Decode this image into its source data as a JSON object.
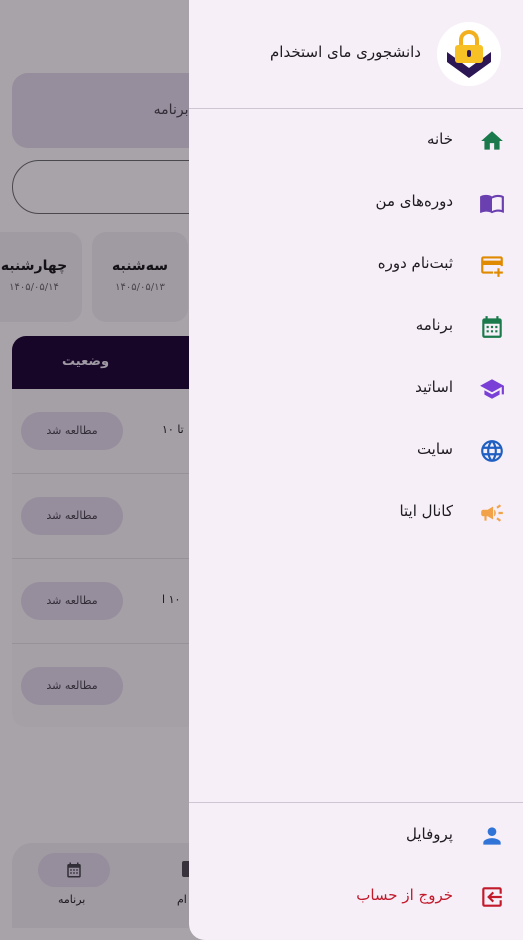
{
  "background": {
    "search_placeholder": "جستجو در برنامه",
    "days": [
      {
        "name": "چهارشنبه",
        "date": "۱۴۰۵/۰۵/۱۴"
      },
      {
        "name": "سه‌شنبه",
        "date": "۱۴۰۵/۰۵/۱۳"
      }
    ],
    "table_header": "وضعیت",
    "rows": [
      {
        "status": "مطالعه شد",
        "text": "تا ۱۰"
      },
      {
        "status": "مطالعه شد",
        "text": ""
      },
      {
        "status": "مطالعه شد",
        "text": "۱۰ ا"
      },
      {
        "status": "مطالعه شد",
        "text": ""
      }
    ],
    "bottom_nav": {
      "active_label": "برنامه",
      "second_label": "ام"
    }
  },
  "drawer": {
    "title": "دانشجوری مای استخدام",
    "menu": [
      {
        "label": "خانه",
        "icon": "home-icon",
        "color": "#1b7a4b"
      },
      {
        "label": "دوره‌های من",
        "icon": "book-icon",
        "color": "#6a3fb0"
      },
      {
        "label": "ثبت‌نام دوره",
        "icon": "card-add-icon",
        "color": "#e08a00"
      },
      {
        "label": "برنامه",
        "icon": "calendar-icon",
        "color": "#1b7a4b"
      },
      {
        "label": "اساتید",
        "icon": "graduation-cap-icon",
        "color": "#7a3fd6"
      },
      {
        "label": "سایت",
        "icon": "globe-icon",
        "color": "#1f5fc2"
      },
      {
        "label": "کانال ایتا",
        "icon": "megaphone-icon",
        "color": "#f2a34a"
      }
    ],
    "footer": [
      {
        "label": "پروفایل",
        "icon": "person-icon",
        "color": "#2f74d6"
      },
      {
        "label": "خروج از حساب",
        "icon": "logout-icon",
        "color": "#c2192b"
      }
    ]
  }
}
